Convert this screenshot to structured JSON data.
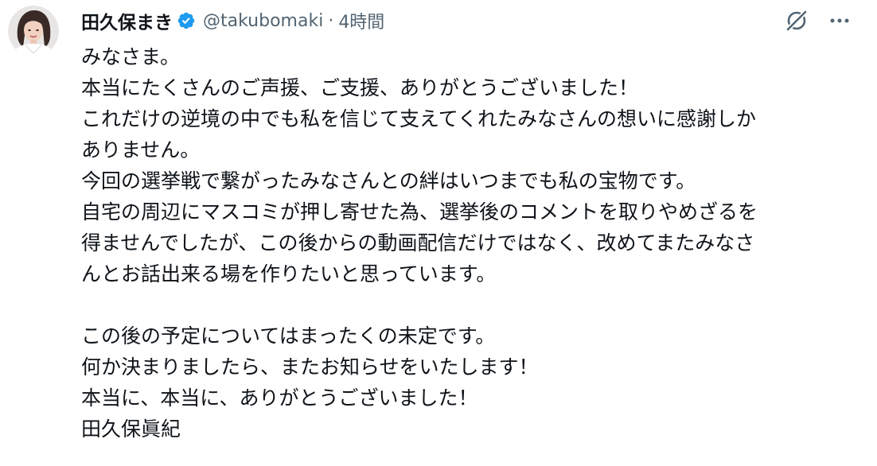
{
  "author": {
    "display_name": "田久保まき",
    "handle": "@takubomaki",
    "separator": "·",
    "timestamp": "4時間",
    "verified_icon": "verified-badge-icon",
    "avatar_icon": "avatar-photo"
  },
  "actions": {
    "grok_icon": "grok-icon",
    "more_icon": "more-horizontal-icon"
  },
  "colors": {
    "text": "#0f1419",
    "secondary": "#536471",
    "verified": "#1d9bf0"
  },
  "tweet": {
    "lines": [
      "みなさま。",
      "本当にたくさんのご声援、ご支援、ありがとうございました！",
      "これだけの逆境の中でも私を信じて支えてくれたみなさんの想いに感謝しか",
      "ありません。",
      "今回の選挙戦で繋がったみなさんとの絆はいつまでも私の宝物です。",
      "自宅の周辺にマスコミが押し寄せた為、選挙後のコメントを取りやめざるを",
      "得ませんでしたが、この後からの動画配信だけではなく、改めてまたみなさ",
      "んとお話出来る場を作りたいと思っています。",
      "",
      "この後の予定についてはまったくの未定です。",
      "何か決まりましたら、またお知らせをいたします！",
      "本当に、本当に、ありがとうございました！",
      "田久保眞紀"
    ]
  }
}
